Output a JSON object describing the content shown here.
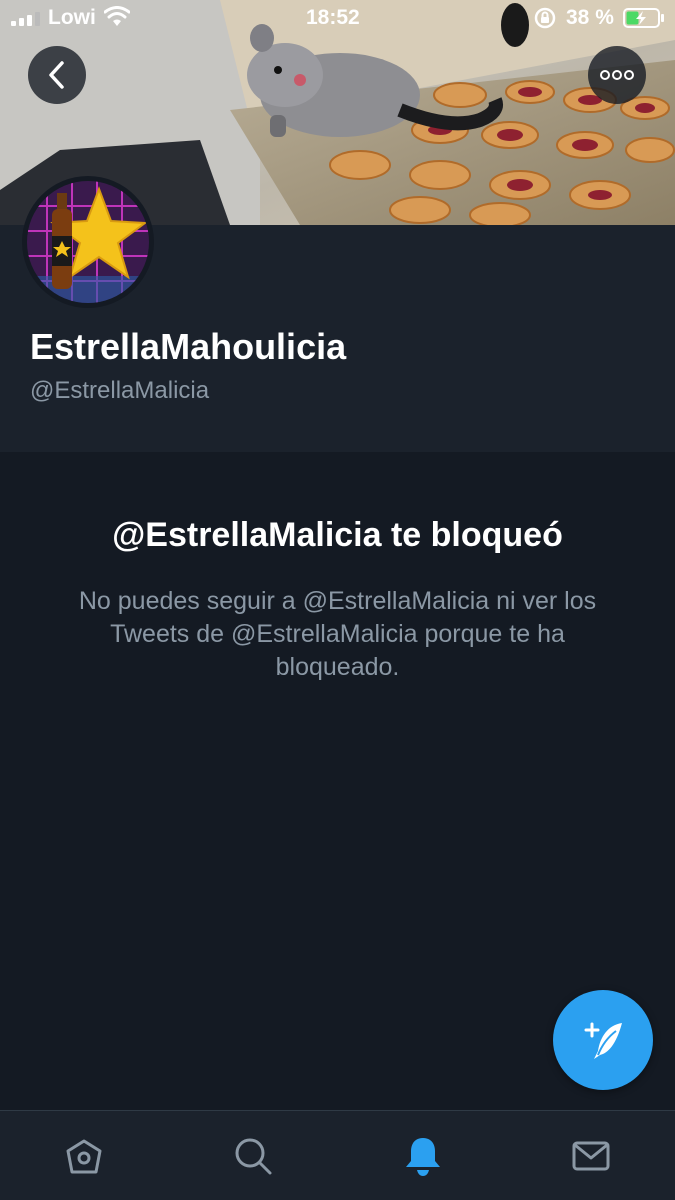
{
  "status_bar": {
    "carrier": "Lowi",
    "time": "18:52",
    "battery": "38 %"
  },
  "profile": {
    "display_name": "EstrellaMahoulicia",
    "handle": "@EstrellaMalicia"
  },
  "blocked": {
    "title": "@EstrellaMalicia te bloqueó",
    "description": "No puedes seguir a @EstrellaMalicia ni ver los Tweets de @EstrellaMalicia porque te ha bloqueado."
  },
  "tabs": [
    {
      "icon": "home-icon"
    },
    {
      "icon": "search-icon"
    },
    {
      "icon": "notifications-icon",
      "active": true
    },
    {
      "icon": "messages-icon"
    }
  ],
  "colors": {
    "background": "#141a23",
    "surface": "#1b222c",
    "accent": "#2ba0f0",
    "secondary_text": "#8b98a5"
  }
}
